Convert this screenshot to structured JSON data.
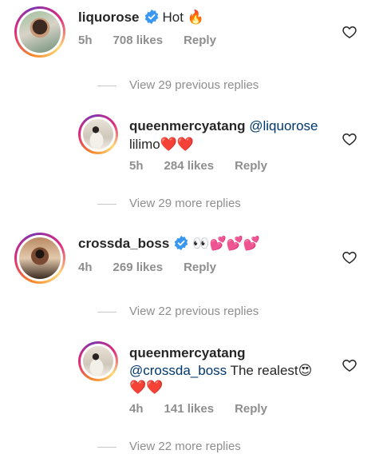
{
  "comments": [
    {
      "username": "liquorose",
      "verified": true,
      "text": "Hot 🔥",
      "time": "5h",
      "likes": "708 likes",
      "reply_label": "Reply"
    },
    {
      "view_label": "View 29 previous replies"
    },
    {
      "username": "queenmercyatang",
      "mention": "@liquorose",
      "text": "lilimo❤️❤️",
      "time": "5h",
      "likes": "284 likes",
      "reply_label": "Reply"
    },
    {
      "view_label": "View 29 more replies"
    },
    {
      "username": "crossda_boss",
      "verified": true,
      "text": "👀💕💕💕",
      "time": "4h",
      "likes": "269 likes",
      "reply_label": "Reply"
    },
    {
      "view_label": "View 22 previous replies"
    },
    {
      "username": "queenmercyatang",
      "mention": "@crossda_boss",
      "text": "The realest😍",
      "text2": "❤️❤️",
      "time": "4h",
      "likes": "141 likes",
      "reply_label": "Reply"
    },
    {
      "view_label": "View 22 more replies"
    }
  ],
  "colors": {
    "verified": "#3897f0",
    "meta_text": "#8e8e8e",
    "mention": "#00376b"
  },
  "icons": {
    "verified": "verified-badge-icon",
    "like": "heart-outline-icon"
  }
}
